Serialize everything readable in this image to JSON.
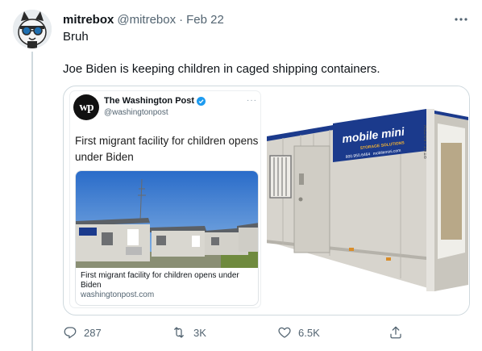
{
  "tweet": {
    "author_name": "mitrebox",
    "author_handle": "@mitrebox",
    "separator": "·",
    "date": "Feb 22",
    "text_line1": "Bruh",
    "text_line2": "Joe Biden is keeping children in caged shipping containers."
  },
  "embedded": {
    "logo_text": "wp",
    "account_name": "The Washington Post",
    "account_handle": "@washingtonpost",
    "more": "···",
    "headline": "First migrant facility for children opens under Biden",
    "card_title": "First migrant facility for children opens under Biden",
    "card_link": "washingtonpost.com",
    "photo_sign": "mobile mini"
  },
  "container": {
    "brand": "mobile mini",
    "tagline": "STORAGE SOLUTIONS",
    "phone": "800.950.6464",
    "site": "mobilemini.com",
    "serial": "AS20VT1018"
  },
  "actions": {
    "replies": "287",
    "retweets": "3K",
    "likes": "6.5K"
  },
  "colors": {
    "text_primary": "#0f1419",
    "text_secondary": "#536471",
    "border": "#cfd9de",
    "verified": "#1d9bf0",
    "container_blue": "#1b3a8c"
  }
}
